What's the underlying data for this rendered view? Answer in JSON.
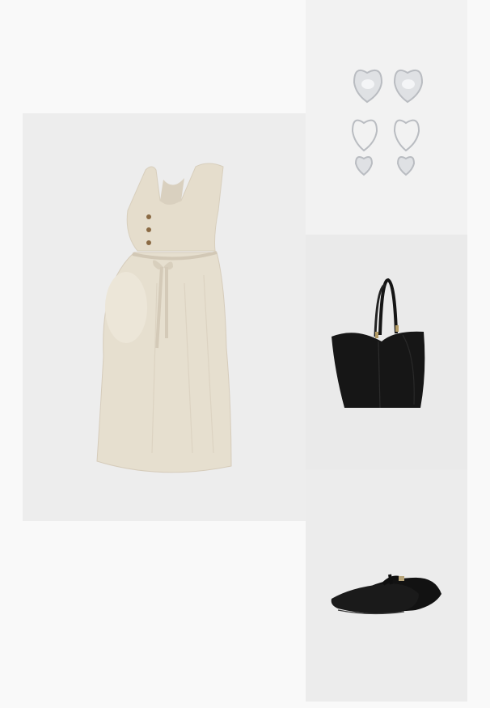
{
  "outfit": {
    "items": [
      {
        "id": "dress",
        "icon": "maternity-dress-image",
        "color": "#e4dccb"
      },
      {
        "id": "earrings",
        "icon": "heart-earrings-image",
        "color": "#d7d9dc"
      },
      {
        "id": "bag",
        "icon": "tote-bag-image",
        "color": "#141414"
      },
      {
        "id": "shoes",
        "icon": "mary-jane-flats-image",
        "color": "#141414"
      }
    ]
  }
}
